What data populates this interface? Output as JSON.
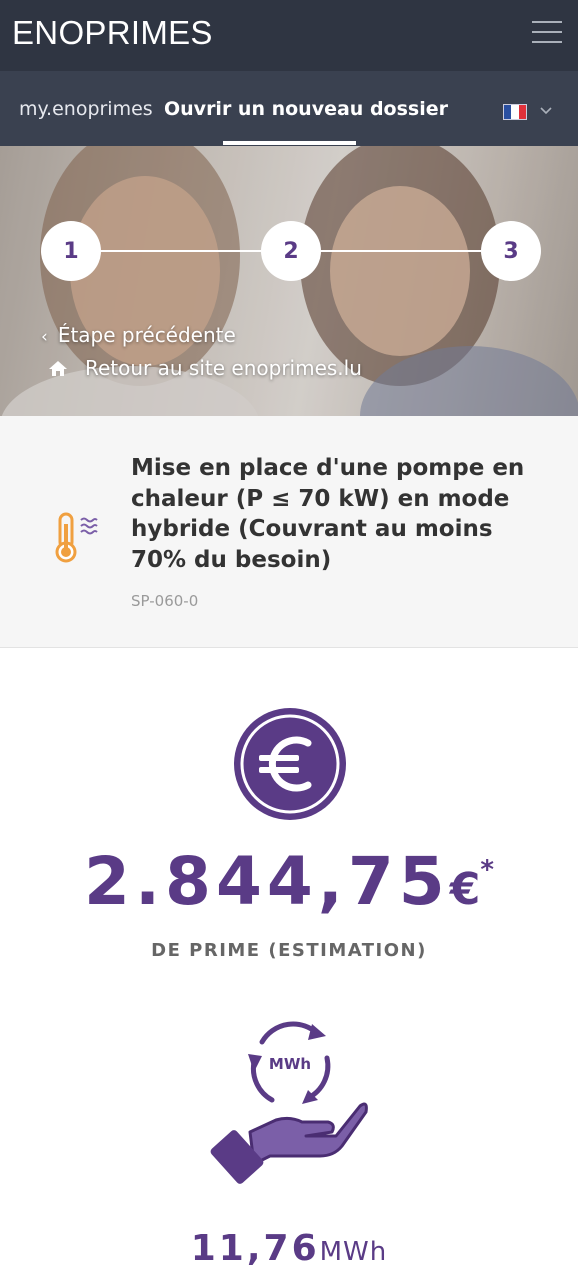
{
  "header": {
    "brand": "ENOPRIMES",
    "menu_icon": "hamburger-menu-icon"
  },
  "nav": {
    "my_link": "my.enoprimes",
    "new_file_link": "Ouvrir un nouveau dossier",
    "language_icon": "french-flag-icon",
    "language_dropdown_icon": "chevron-down-icon"
  },
  "steps": {
    "items": [
      "1",
      "2",
      "3"
    ],
    "previous_label": "Étape précédente",
    "previous_icon": "chevron-left-icon",
    "back_label": "Retour au site enoprimes.lu",
    "back_icon": "home-icon"
  },
  "product": {
    "icon": "thermometer-heat-pump-icon",
    "title": "Mise en place d'une pompe en chaleur (P ≤ 70 kW) en mode hybride (Couvrant au moins 70% du besoin)",
    "code": "SP-060-0"
  },
  "prime": {
    "icon": "euro-icon",
    "value": "2.844,75",
    "currency": "€",
    "asterisk": "*",
    "label": "DE PRIME (ESTIMATION)"
  },
  "energy": {
    "icon": "hand-mwh-cycle-icon",
    "icon_text": "MWh",
    "value": "11,76",
    "unit": "MWh"
  },
  "colors": {
    "topbar": "#2f3542",
    "navbar": "#3a4150",
    "accent_purple": "#5a3b86",
    "icon_orange": "#f0a040"
  }
}
